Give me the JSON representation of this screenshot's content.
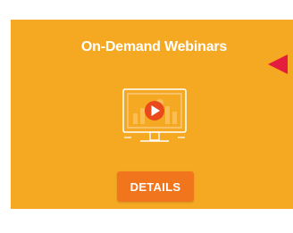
{
  "card": {
    "title": "On-Demand Webinars",
    "background_color": "#f5a922",
    "icon": "monitor-play-icon",
    "button_label": "DETAILS",
    "button_color": "#f1751d"
  },
  "pointer": {
    "icon": "left-arrow-triangle-icon",
    "color": "#e41c3e"
  }
}
